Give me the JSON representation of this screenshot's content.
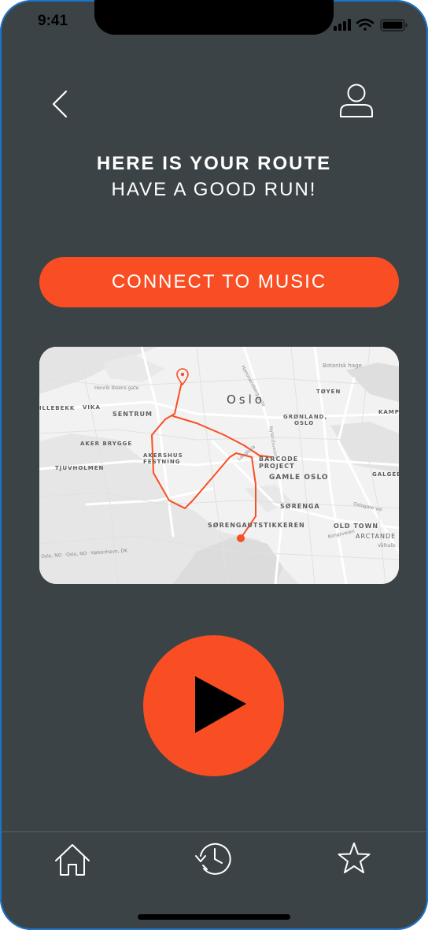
{
  "status_bar": {
    "time": "9:41"
  },
  "header": {
    "title": "HERE IS YOUR ROUTE",
    "subtitle": "HAVE A GOOD RUN!"
  },
  "actions": {
    "connect_music_label": "CONNECT TO MUSIC"
  },
  "map": {
    "city": "Oslo",
    "districts": [
      "SENTRUM",
      "VIKA",
      "ILLEBEKK",
      "AKER BRYGGE",
      "TJUVHOLMEN",
      "AKERSHUS",
      "FESTNING",
      "GRØNLAND,",
      "OSLO",
      "TØYEN",
      "KAMP",
      "BARCODE",
      "PROJECT",
      "GAMLE OSLO",
      "GALGEBE",
      "SØRENGA",
      "SØRENGAUTSTIKKEREN",
      "OLD TOWN",
      "ARCTANDE"
    ],
    "streets": [
      "Henrik Ibsens gate",
      "Botanisk hage",
      "Hammersborg gate",
      "Nylandsveien",
      "Langkaia",
      "Oslogate vei",
      "Kongsveien",
      "Vålhalls",
      "Oslo, NO · Oslo, NO · København, DK"
    ]
  },
  "colors": {
    "background": "#3c4346",
    "accent": "#f94e23",
    "text": "#ffffff",
    "route": "#f94e23"
  },
  "icons": {
    "back": "chevron-left-icon",
    "profile": "user-icon",
    "play": "play-icon",
    "home": "home-icon",
    "history": "history-icon",
    "favorites": "star-icon"
  }
}
